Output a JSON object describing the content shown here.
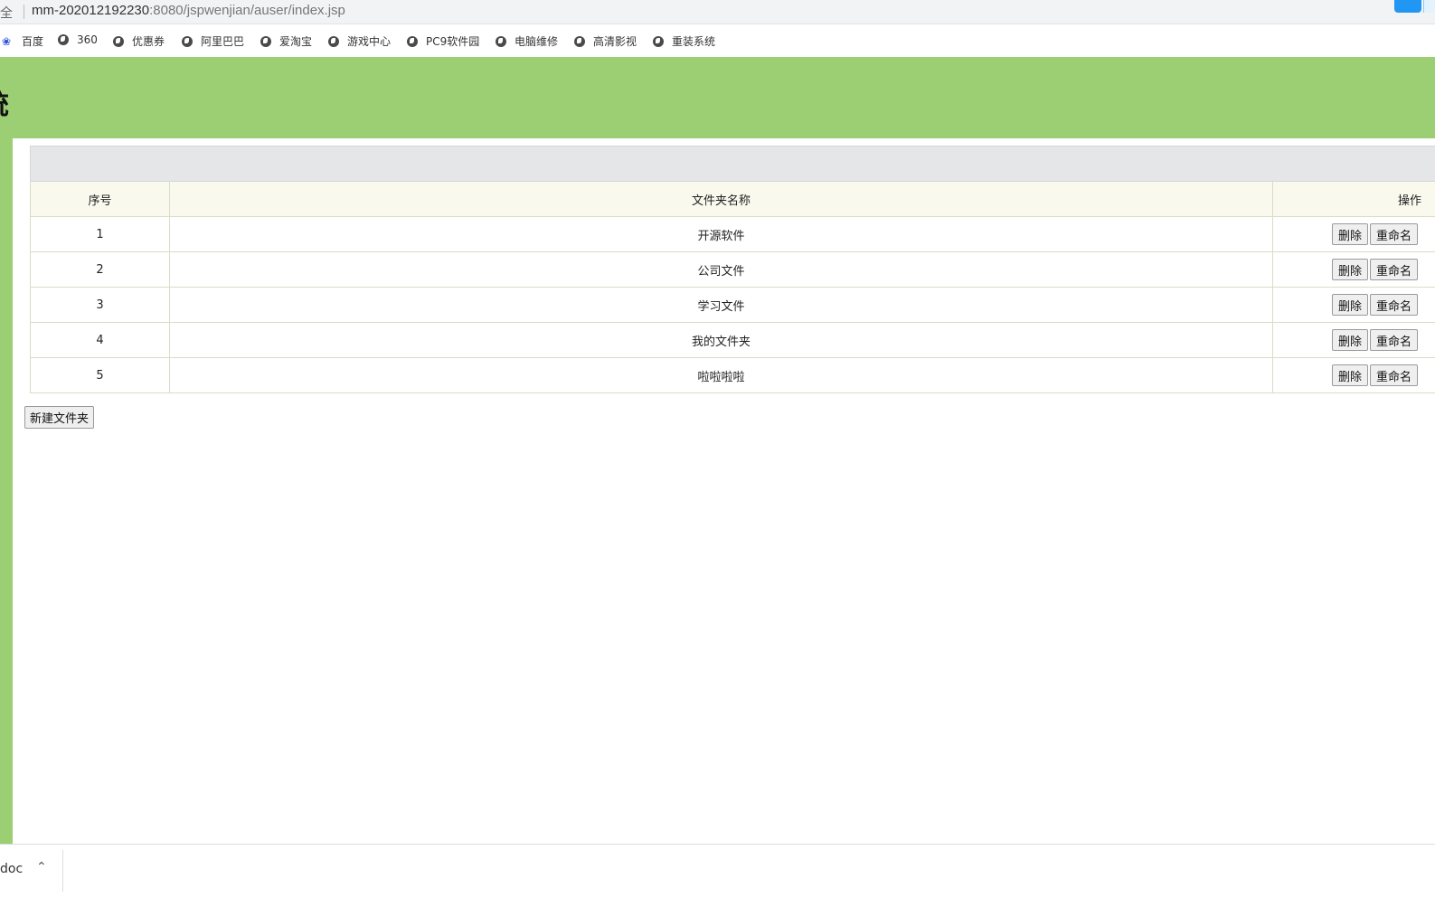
{
  "address_bar": {
    "security_text": "安全",
    "url_host": "mm-202012192230",
    "url_rest": ":8080/jspwenjian/auser/index.jsp"
  },
  "bookmarks": [
    {
      "label": "百度",
      "icon": "baidu-paw-icon"
    },
    {
      "label": "360",
      "icon": "globe-icon"
    },
    {
      "label": "优惠券",
      "icon": "globe-icon"
    },
    {
      "label": "阿里巴巴",
      "icon": "globe-icon"
    },
    {
      "label": "爱淘宝",
      "icon": "globe-icon"
    },
    {
      "label": "游戏中心",
      "icon": "globe-icon"
    },
    {
      "label": "PC9软件园",
      "icon": "globe-icon"
    },
    {
      "label": "电脑维修",
      "icon": "globe-icon"
    },
    {
      "label": "高清影视",
      "icon": "globe-icon"
    },
    {
      "label": "重装系统",
      "icon": "globe-icon"
    }
  ],
  "header": {
    "title": "统"
  },
  "table": {
    "columns": [
      "序号",
      "文件夹名称",
      "操作"
    ],
    "rows": [
      {
        "index": "1",
        "name": "开源软件"
      },
      {
        "index": "2",
        "name": "公司文件"
      },
      {
        "index": "3",
        "name": "学习文件"
      },
      {
        "index": "4",
        "name": "我的文件夹"
      },
      {
        "index": "5",
        "name": "啦啦啦啦"
      }
    ],
    "delete_label": "删除",
    "rename_label": "重命名"
  },
  "new_folder_label": "新建文件夹",
  "download_bar": {
    "file_name": "doc"
  },
  "colors": {
    "header_green": "#9ccf73",
    "table_header_bg": "#f9f9ee",
    "caption_bg": "#e5e6e7"
  }
}
